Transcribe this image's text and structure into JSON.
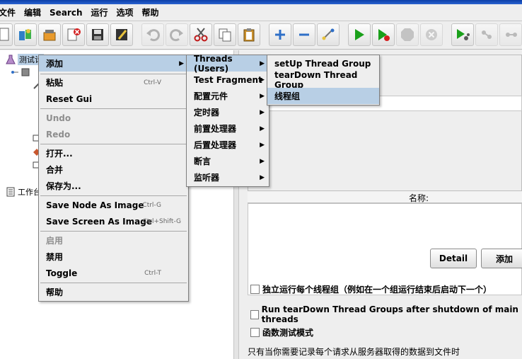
{
  "menubar": [
    "文件",
    "编辑",
    "Search",
    "运行",
    "选项",
    "帮助"
  ],
  "toolbar_icons": [
    "new-icon",
    "templates-icon",
    "open-icon",
    "close-icon",
    "save-icon",
    "save-as-icon",
    "undo-icon",
    "redo-icon",
    "cut-icon",
    "copy-icon",
    "paste-icon",
    "expand-icon",
    "collapse-icon",
    "toggle-icon",
    "start-icon",
    "start-no-pause-icon",
    "stop-icon",
    "shutdown-icon",
    "remote-start-icon",
    "remote-stop-icon",
    "remote-exit-icon"
  ],
  "tree": {
    "test_plan": "测试计",
    "workbench": "工作台"
  },
  "context_menu": {
    "items": [
      {
        "label": "添加",
        "submenu": true
      },
      {
        "label": "粘贴",
        "accel": "Ctrl-V"
      },
      {
        "label": "Reset Gui"
      },
      {
        "label": "Undo",
        "disabled": true
      },
      {
        "label": "Redo",
        "disabled": true
      },
      {
        "label": "打开..."
      },
      {
        "label": "合并"
      },
      {
        "label": "保存为..."
      },
      {
        "label": "Save Node As Image",
        "accel": "Ctrl-G"
      },
      {
        "label": "Save Screen As Image",
        "accel": "Ctrl+Shift-G"
      },
      {
        "label": "启用",
        "disabled": true
      },
      {
        "label": "禁用"
      },
      {
        "label": "Toggle",
        "accel": "Ctrl-T"
      },
      {
        "label": "帮助"
      }
    ]
  },
  "add_submenu": {
    "items": [
      {
        "label": "Threads (Users)"
      },
      {
        "label": "Test Fragment"
      },
      {
        "label": "配置元件"
      },
      {
        "label": "定时器"
      },
      {
        "label": "前置处理器"
      },
      {
        "label": "后置处理器"
      },
      {
        "label": "断言"
      },
      {
        "label": "监听器"
      }
    ]
  },
  "threads_submenu": {
    "items": [
      {
        "label": "setUp Thread Group"
      },
      {
        "label": "tearDown Thread Group"
      },
      {
        "label": "线程组"
      }
    ]
  },
  "right_panel": {
    "name_column": "名称:",
    "detail_button": "Detail",
    "add_button": "添加",
    "options": [
      "独立运行每个线程组（例如在一个组运行结束后启动下一个）",
      "Run tearDown Thread Groups after shutdown of main threads",
      "函数测试模式"
    ],
    "note": "只有当你需要记录每个请求从服务器取得的数据到文件时"
  },
  "colors": {
    "highlight": "#b8cfe5",
    "menu_bg": "#eeeeee",
    "start_green": "#1aa01a"
  }
}
